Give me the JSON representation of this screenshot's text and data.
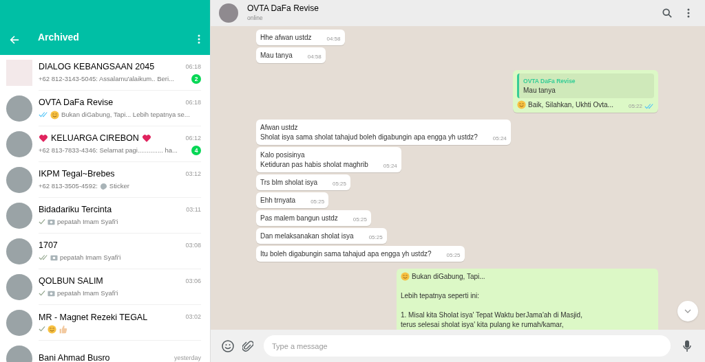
{
  "sidebar": {
    "title": "Archived",
    "chats": [
      {
        "avatar": {
          "kind": "logo"
        },
        "name": "DIALOG KEBANGSAAN 2045",
        "hearts": false,
        "time": "06:18",
        "preview": "+62 812-3143-5045: Assalamu'alaikum.. Beri...",
        "unread": "2"
      },
      {
        "avatar": {
          "kind": "photo"
        },
        "name": "OVTA DaFa Revise",
        "hearts": false,
        "time": "06:18",
        "ticks": {
          "kind": "read"
        },
        "emoji": [
          {
            "kind": "smile"
          }
        ],
        "preview": "Bukan diGabung, Tapi... Lebih tepatnya se..."
      },
      {
        "avatar": {
          "kind": "photo"
        },
        "name": "KELUARGA CIREBON",
        "hearts": true,
        "time": "06:12",
        "preview": "+62 813-7833-4346: Selamat pagi.............. ha...",
        "unread": "4"
      },
      {
        "avatar": {
          "kind": "photo"
        },
        "name": "IKPM Tegal~Brebes",
        "hearts": false,
        "time": "03:12",
        "attachment": {
          "kind": "sticker"
        },
        "prefix": "+62 813-3505-4592:",
        "preview": "Sticker"
      },
      {
        "avatar": {
          "kind": "photo"
        },
        "name": "Bidadariku Tercinta",
        "hearts": false,
        "time": "03:11",
        "ticks": {
          "kind": "sent"
        },
        "attachment": {
          "kind": "photo"
        },
        "preview": "pepatah Imam Syafi'i"
      },
      {
        "avatar": {
          "kind": "photo"
        },
        "name": "1707",
        "hearts": false,
        "time": "03:08",
        "ticks": {
          "kind": "delivered"
        },
        "attachment": {
          "kind": "photo"
        },
        "preview": "pepatah Imam Syafi'i"
      },
      {
        "avatar": {
          "kind": "photo"
        },
        "name": "QOLBUN SALIM",
        "hearts": false,
        "time": "03:06",
        "ticks": {
          "kind": "sent"
        },
        "attachment": {
          "kind": "photo"
        },
        "preview": "pepatah Imam Syafi'i"
      },
      {
        "avatar": {
          "kind": "photo"
        },
        "name": "MR - Magnet Rezeki TEGAL",
        "hearts": false,
        "time": "03:02",
        "ticks": {
          "kind": "sent"
        },
        "emoji": [
          {
            "kind": "smile"
          },
          {
            "kind": "thumbs"
          }
        ]
      },
      {
        "avatar": {
          "kind": "photo"
        },
        "name": "Bani Ahmad Busro",
        "hearts": false,
        "time": "yesterday"
      }
    ]
  },
  "chat": {
    "name": "OVTA DaFa Revise",
    "presence": "online",
    "messages": [
      {
        "kind": "incoming",
        "paragraphs": [
          [
            "Hhe afwan ustdz"
          ]
        ],
        "time": "04:58"
      },
      {
        "kind": "incoming",
        "paragraphs": [
          [
            "Mau tanya"
          ]
        ],
        "time": "04:58"
      },
      {
        "kind": "outgoing",
        "quote": {
          "author": "OVTA DaFa Revise",
          "text": "Mau tanya"
        },
        "emoji": {
          "kind": "smile"
        },
        "paragraphs": [
          [
            "Baik, Silahkan, Ukhti Ovta..."
          ]
        ],
        "time": "05:22",
        "ticks": {
          "kind": "read"
        }
      },
      {
        "kind": "incoming",
        "paragraphs": [
          [
            "Afwan ustdz",
            "Sholat isya sama sholat tahajud boleh digabungin apa engga yh ustdz?"
          ]
        ],
        "time": "05:24"
      },
      {
        "kind": "incoming",
        "paragraphs": [
          [
            "Kalo posisinya",
            "Ketiduran pas habis sholat maghrib"
          ]
        ],
        "time": "05:24"
      },
      {
        "kind": "incoming",
        "paragraphs": [
          [
            "Trs blm sholat isya"
          ]
        ],
        "time": "05:25"
      },
      {
        "kind": "incoming",
        "paragraphs": [
          [
            "Ehh trnyata"
          ]
        ],
        "time": "05:25"
      },
      {
        "kind": "incoming",
        "paragraphs": [
          [
            "Pas malem bangun ustdz"
          ]
        ],
        "time": "05:25"
      },
      {
        "kind": "incoming",
        "paragraphs": [
          [
            "Dan melaksanakan sholat isya"
          ]
        ],
        "time": "05:25"
      },
      {
        "kind": "incoming",
        "paragraphs": [
          [
            "Itu boleh digabungin sama tahajud apa engga yh ustdz?"
          ]
        ],
        "time": "05:25"
      },
      {
        "kind": "outgoing",
        "emoji": {
          "kind": "smile"
        },
        "paragraphs": [
          [
            "Bukan diGabung, Tapi..."
          ],
          [
            "Lebih tepatnya seperti ini:"
          ],
          [
            "1. Misal kita Sholat isya' Tepat Waktu berJama'ah di Masjid,",
            "terus selesai sholat isya' kita pulang ke rumah/kamar,"
          ]
        ]
      }
    ]
  },
  "composer": {
    "placeholder": "Type a message"
  }
}
